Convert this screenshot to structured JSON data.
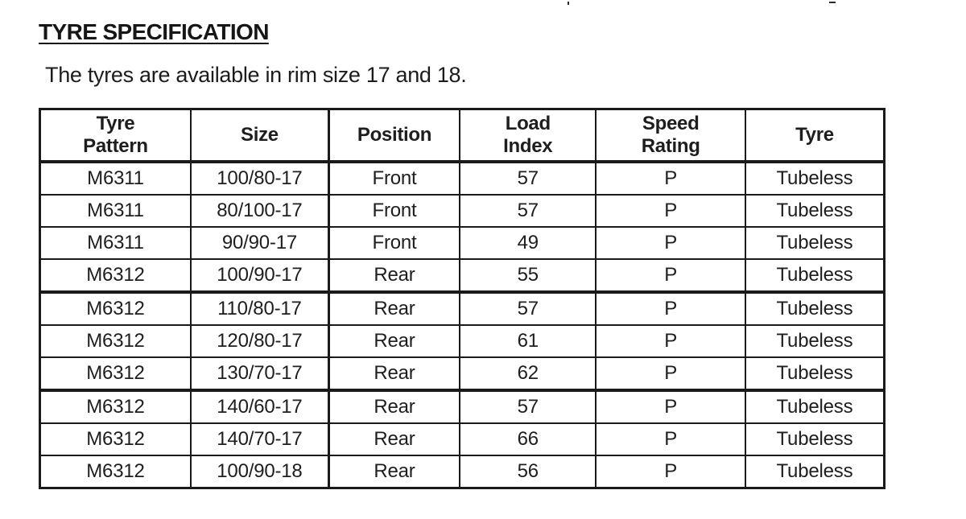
{
  "section": {
    "title": "TYRE SPECIFICATION",
    "intro": "The tyres are available in rim size 17 and 18."
  },
  "table": {
    "headers": [
      {
        "line1": "Tyre",
        "line2": "Pattern"
      },
      {
        "line1": "Size",
        "line2": ""
      },
      {
        "line1": "Position",
        "line2": ""
      },
      {
        "line1": "Load",
        "line2": "Index"
      },
      {
        "line1": "Speed",
        "line2": "Rating"
      },
      {
        "line1": "Tyre",
        "line2": ""
      }
    ],
    "rows": [
      {
        "pattern": "M6311",
        "size": "100/80-17",
        "position": "Front",
        "load_index": "57",
        "speed_rating": "P",
        "tyre": "Tubeless"
      },
      {
        "pattern": "M6311",
        "size": "80/100-17",
        "position": "Front",
        "load_index": "57",
        "speed_rating": "P",
        "tyre": "Tubeless"
      },
      {
        "pattern": "M6311",
        "size": "90/90-17",
        "position": "Front",
        "load_index": "49",
        "speed_rating": "P",
        "tyre": "Tubeless"
      },
      {
        "pattern": "M6312",
        "size": "100/90-17",
        "position": "Rear",
        "load_index": "55",
        "speed_rating": "P",
        "tyre": "Tubeless"
      },
      {
        "pattern": "M6312",
        "size": "110/80-17",
        "position": "Rear",
        "load_index": "57",
        "speed_rating": "P",
        "tyre": "Tubeless"
      },
      {
        "pattern": "M6312",
        "size": "120/80-17",
        "position": "Rear",
        "load_index": "61",
        "speed_rating": "P",
        "tyre": "Tubeless"
      },
      {
        "pattern": "M6312",
        "size": "130/70-17",
        "position": "Rear",
        "load_index": "62",
        "speed_rating": "P",
        "tyre": "Tubeless"
      },
      {
        "pattern": "M6312",
        "size": "140/60-17",
        "position": "Rear",
        "load_index": "57",
        "speed_rating": "P",
        "tyre": "Tubeless"
      },
      {
        "pattern": "M6312",
        "size": "140/70-17",
        "position": "Rear",
        "load_index": "66",
        "speed_rating": "P",
        "tyre": "Tubeless"
      },
      {
        "pattern": "M6312",
        "size": "100/90-18",
        "position": "Rear",
        "load_index": "56",
        "speed_rating": "P",
        "tyre": "Tubeless"
      }
    ]
  }
}
